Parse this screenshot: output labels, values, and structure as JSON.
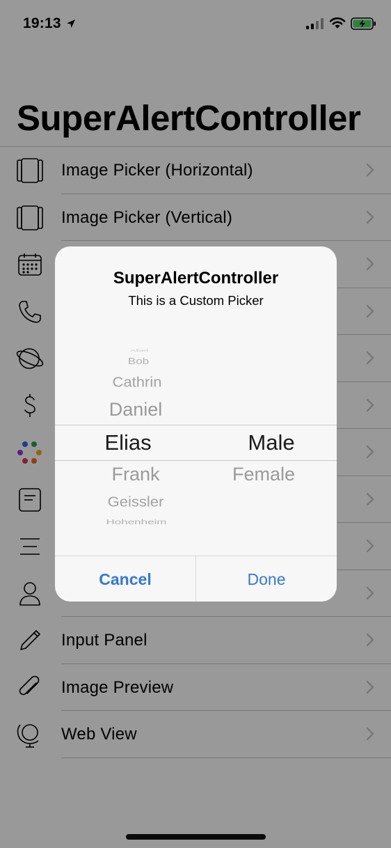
{
  "status_bar": {
    "time": "19:13",
    "icons": [
      "location-arrow-icon",
      "cellular-signal-icon",
      "wifi-icon",
      "battery-charging-icon"
    ]
  },
  "page": {
    "title": "SuperAlertController"
  },
  "list": {
    "items": [
      {
        "label": "Image Picker (Horizontal)",
        "icon": "image-picker-horizontal-icon"
      },
      {
        "label": "Image Picker (Vertical)",
        "icon": "image-picker-vertical-icon"
      },
      {
        "label": "",
        "icon": "calendar-icon"
      },
      {
        "label": "",
        "icon": "phone-icon"
      },
      {
        "label": "",
        "icon": "planet-icon"
      },
      {
        "label": "",
        "icon": "dollar-icon"
      },
      {
        "label": "",
        "icon": "color-dots-icon"
      },
      {
        "label": "",
        "icon": "document-icon"
      },
      {
        "label": "",
        "icon": "lines-icon"
      },
      {
        "label": "",
        "icon": "person-icon"
      },
      {
        "label": "Input Panel",
        "icon": "pencil-icon"
      },
      {
        "label": "Image Preview",
        "icon": "paperclip-icon"
      },
      {
        "label": "Web View",
        "icon": "globe-icon"
      }
    ]
  },
  "alert": {
    "title": "SuperAlertController",
    "message": "This is a Custom Picker",
    "picker": {
      "names": [
        "Abel",
        "Bob",
        "Cathrin",
        "Daniel",
        "Elias",
        "Frank",
        "Geissler",
        "Hohenheim"
      ],
      "selected_name": "Elias",
      "genders": [
        "Male",
        "Female"
      ],
      "selected_gender": "Male"
    },
    "cancel_label": "Cancel",
    "done_label": "Done"
  },
  "colors": {
    "accent": "#3478d6",
    "dim_overlay": "rgba(0,0,0,0.4)",
    "alert_background": "#f7f7f7"
  }
}
